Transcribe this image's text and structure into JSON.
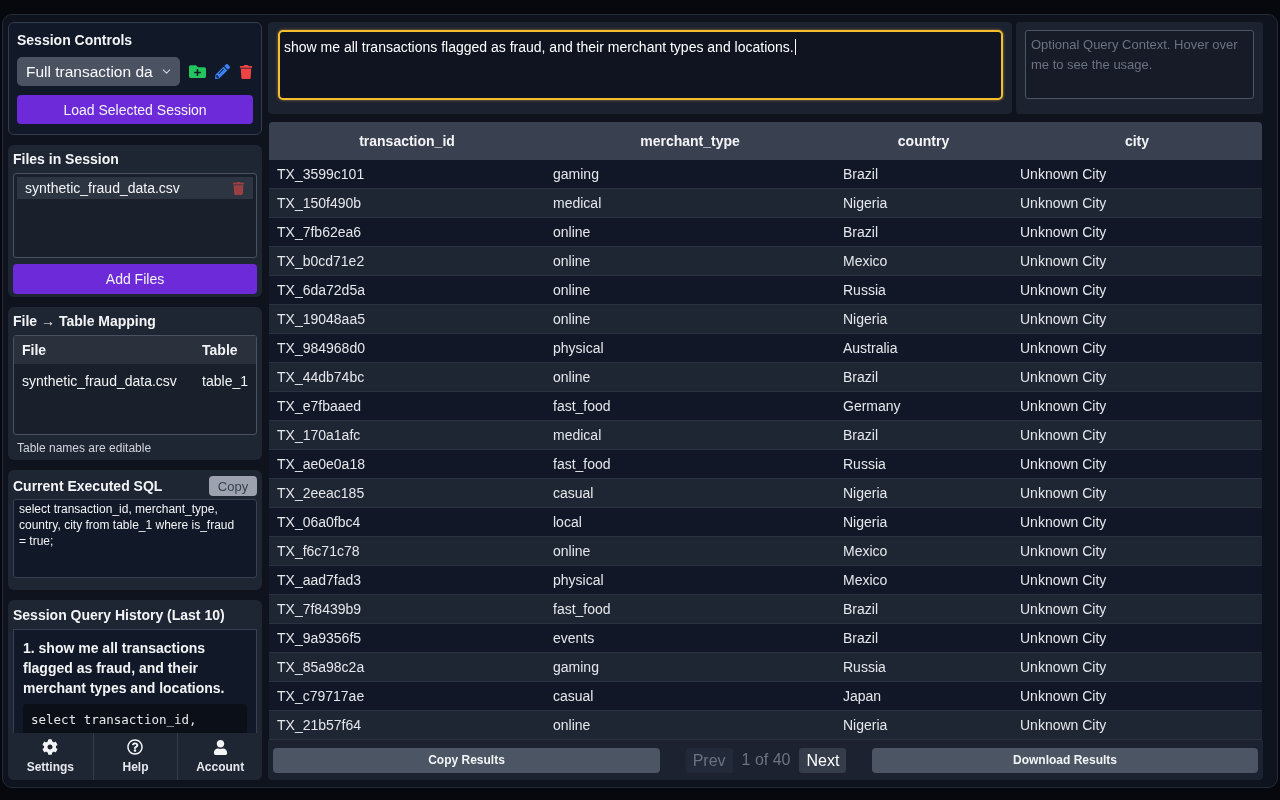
{
  "session_controls": {
    "title": "Session Controls",
    "session_select": {
      "value": "Full transaction da"
    },
    "load_button": "Load Selected Session"
  },
  "files_in_session": {
    "title": "Files in Session",
    "files": [
      "synthetic_fraud_data.csv"
    ],
    "add_button": "Add Files"
  },
  "file_table_mapping": {
    "title": "File → Table Mapping",
    "columns": [
      "File",
      "Table"
    ],
    "rows": [
      [
        "synthetic_fraud_data.csv",
        "table_1"
      ]
    ],
    "note": "Table names are editable"
  },
  "current_sql": {
    "title": "Current Executed SQL",
    "copy_button": "Copy",
    "sql": "select transaction_id, merchant_type, country, city from table_1 where is_fraud = true;"
  },
  "query_history": {
    "title": "Session Query History (Last 10)",
    "entries": [
      {
        "question": "1. show me all transactions flagged as fraud, and their merchant types and locations.",
        "sql": "select transaction_id,"
      }
    ]
  },
  "bottom_nav": [
    {
      "kind": "settings",
      "label": "Settings"
    },
    {
      "kind": "help",
      "label": "Help"
    },
    {
      "kind": "account",
      "label": "Account"
    }
  ],
  "query": {
    "value": "show me all transactions flagged as fraud, and their merchant types and locations.",
    "focused": true
  },
  "query_context": {
    "placeholder": "Optional Query Context. Hover over me to see the usage."
  },
  "results": {
    "columns": [
      "transaction_id",
      "merchant_type",
      "country",
      "city"
    ],
    "rows": [
      [
        "TX_3599c101",
        "gaming",
        "Brazil",
        "Unknown City"
      ],
      [
        "TX_150f490b",
        "medical",
        "Nigeria",
        "Unknown City"
      ],
      [
        "TX_7fb62ea6",
        "online",
        "Brazil",
        "Unknown City"
      ],
      [
        "TX_b0cd71e2",
        "online",
        "Mexico",
        "Unknown City"
      ],
      [
        "TX_6da72d5a",
        "online",
        "Russia",
        "Unknown City"
      ],
      [
        "TX_19048aa5",
        "online",
        "Nigeria",
        "Unknown City"
      ],
      [
        "TX_984968d0",
        "physical",
        "Australia",
        "Unknown City"
      ],
      [
        "TX_44db74bc",
        "online",
        "Brazil",
        "Unknown City"
      ],
      [
        "TX_e7fbaaed",
        "fast_food",
        "Germany",
        "Unknown City"
      ],
      [
        "TX_170a1afc",
        "medical",
        "Brazil",
        "Unknown City"
      ],
      [
        "TX_ae0e0a18",
        "fast_food",
        "Russia",
        "Unknown City"
      ],
      [
        "TX_2eeac185",
        "casual",
        "Nigeria",
        "Unknown City"
      ],
      [
        "TX_06a0fbc4",
        "local",
        "Nigeria",
        "Unknown City"
      ],
      [
        "TX_f6c71c78",
        "online",
        "Mexico",
        "Unknown City"
      ],
      [
        "TX_aad7fad3",
        "physical",
        "Mexico",
        "Unknown City"
      ],
      [
        "TX_7f8439b9",
        "fast_food",
        "Brazil",
        "Unknown City"
      ],
      [
        "TX_9a9356f5",
        "events",
        "Brazil",
        "Unknown City"
      ],
      [
        "TX_85a98c2a",
        "gaming",
        "Russia",
        "Unknown City"
      ],
      [
        "TX_c79717ae",
        "casual",
        "Japan",
        "Unknown City"
      ],
      [
        "TX_21b57f64",
        "online",
        "Nigeria",
        "Unknown City"
      ]
    ]
  },
  "results_footer": {
    "copy_button": "Copy Results",
    "prev": {
      "label": "Prev",
      "disabled": true
    },
    "page": "1 of 40",
    "next": {
      "label": "Next",
      "disabled": false
    },
    "download_button": "Download Results"
  }
}
